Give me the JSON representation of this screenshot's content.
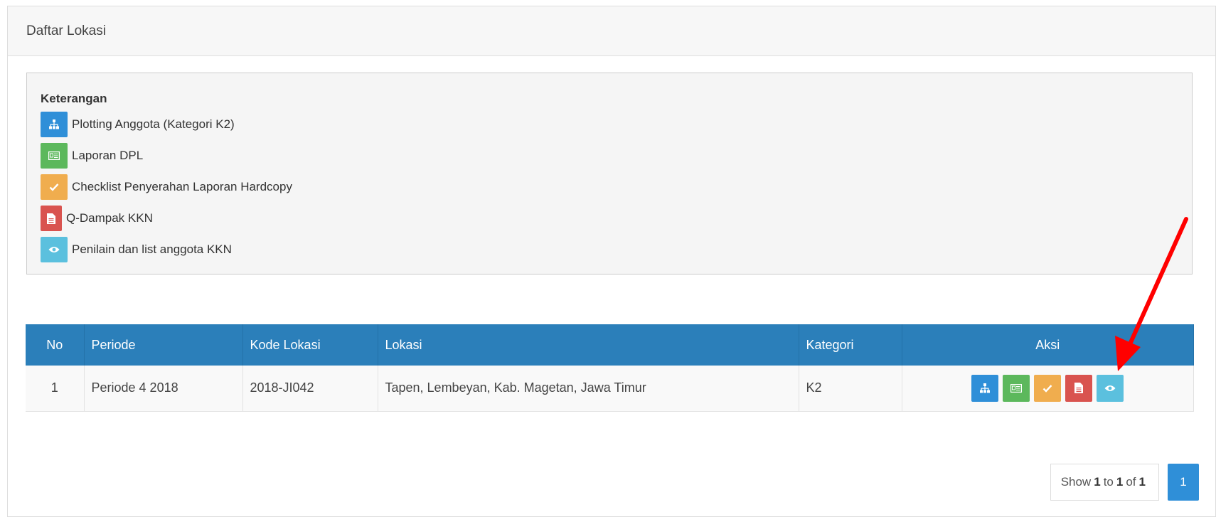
{
  "panel": {
    "title": "Daftar Lokasi"
  },
  "legend": {
    "title": "Keterangan",
    "items": [
      {
        "label": "Plotting Anggota (Kategori K2)",
        "icon": "sitemap-icon",
        "color": "#2f8fd8"
      },
      {
        "label": "Laporan DPL",
        "icon": "id-card-icon",
        "color": "#5cb85c"
      },
      {
        "label": "Checklist Penyerahan Laporan Hardcopy",
        "icon": "check-icon",
        "color": "#f0ad4e"
      },
      {
        "label": "Q-Dampak KKN",
        "icon": "document-icon",
        "color": "#d9534f"
      },
      {
        "label": "Penilain dan list anggota KKN",
        "icon": "eye-icon",
        "color": "#5bc0de"
      }
    ]
  },
  "table": {
    "headers": [
      "No",
      "Periode",
      "Kode Lokasi",
      "Lokasi",
      "Kategori",
      "Aksi"
    ],
    "rows": [
      {
        "no": "1",
        "periode": "Periode 4 2018",
        "kode": "2018-JI042",
        "lokasi": "Tapen, Lembeyan, Kab. Magetan, Jawa Timur",
        "kategori": "K2"
      }
    ],
    "header_color": "#2b7fba"
  },
  "pager": {
    "show": "Show",
    "from": "1",
    "to_word": "to",
    "to": "1",
    "of_word": "of",
    "total": "1",
    "current_page": "1"
  },
  "annotation": {
    "arrow_color": "#ff0000"
  }
}
